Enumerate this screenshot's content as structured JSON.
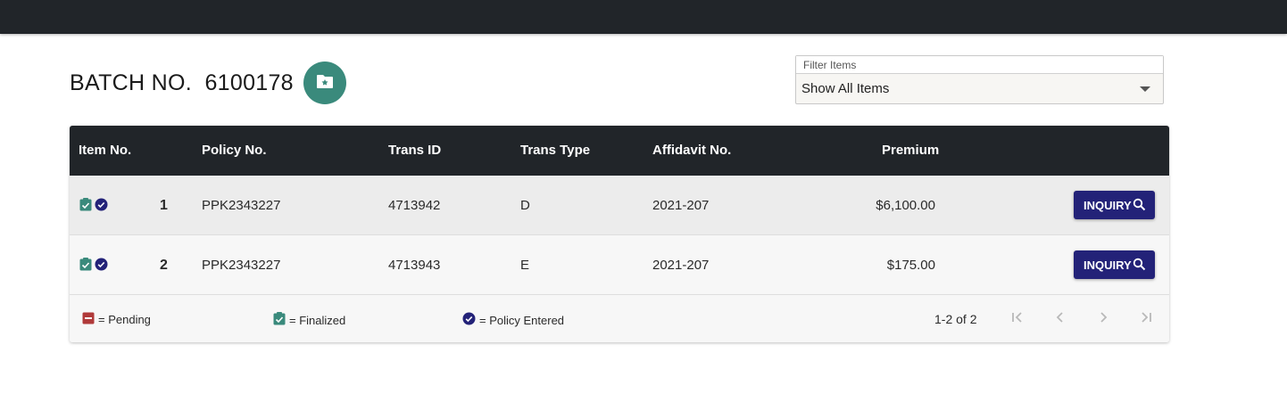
{
  "batch": {
    "title": "BATCH NO.  6100178"
  },
  "icons": {
    "fab": "folder-star-icon",
    "finalized": "clipboard-check-icon",
    "policy_entered": "check-circle-icon",
    "pending": "minus-box-icon",
    "search": "search-icon"
  },
  "filter": {
    "label": "Filter Items",
    "value": "Show All Items"
  },
  "table": {
    "headers": [
      "Item No.",
      "Policy No.",
      "Trans ID",
      "Trans Type",
      "Affidavit No.",
      "Premium"
    ],
    "rows": [
      {
        "item": "1",
        "policy": "PPK2343227",
        "trans_id": "4713942",
        "trans_type": "D",
        "affidavit": "2021-207",
        "premium": "$6,100.00",
        "action": "INQUIRY"
      },
      {
        "item": "2",
        "policy": "PPK2343227",
        "trans_id": "4713943",
        "trans_type": "E",
        "affidavit": "2021-207",
        "premium": "$175.00",
        "action": "INQUIRY"
      }
    ]
  },
  "legend": {
    "pending": "= Pending",
    "finalized": "= Finalized",
    "policy_entered": "= Policy Entered"
  },
  "pagination": {
    "range": "1-2 of 2"
  },
  "colors": {
    "topbar": "#212529",
    "accent_teal": "#3a8a7c",
    "button_navy": "#232278",
    "pending_red": "#b03a3a"
  }
}
